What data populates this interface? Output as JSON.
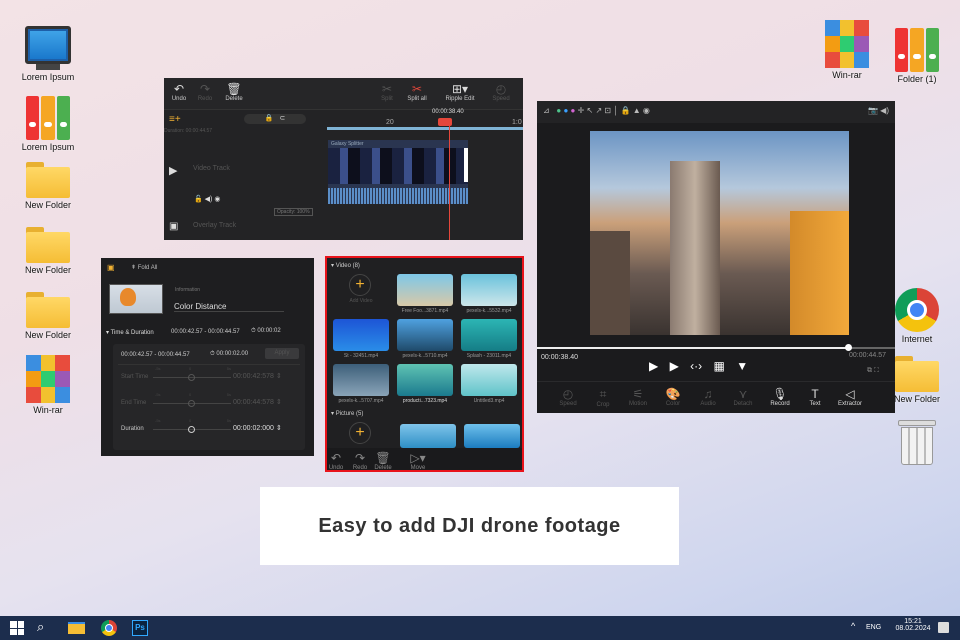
{
  "desktop": {
    "left_icons": [
      "Lorem Ipsum",
      "Lorem Ipsum",
      "New Folder",
      "New Folder",
      "New Folder",
      "Win-rar"
    ],
    "right_icons": [
      "Win-rar",
      "Folder (1)",
      "Internet",
      "New Folder"
    ]
  },
  "timeline": {
    "toolbar": {
      "undo": "Undo",
      "redo": "Redo",
      "delete": "Delete",
      "split": "Split",
      "split_all": "Split all",
      "ripple_edit": "Ripple Edit",
      "speed": "Speed"
    },
    "playhead_time": "00:00:38.40",
    "ruler_label": "20",
    "ruler_label_2": "1:0",
    "duration_label": "Duration: 00:00:44.57",
    "clip_name": "Galaxy Splitter",
    "video_track": "Video Track",
    "overlay_track": "Overlay Track",
    "opacity": "Opacity: 100%"
  },
  "inspector": {
    "fold_all": "Fold All",
    "info_label": "Information",
    "title": "Color Distance",
    "section": "Time & Duration",
    "range": "00:00:42.57 - 00:00:44.57",
    "duration_short": "00:00:02",
    "range2": "00:00:42.57 - 00:00:44.57",
    "duration_full": "00:00:02.00",
    "apply": "Apply",
    "rows": [
      {
        "label": "Start Time",
        "value": "00:00:42:578"
      },
      {
        "label": "End Time",
        "value": "00:00:44:578"
      },
      {
        "label": "Duration",
        "value": "00:00:02:000"
      }
    ],
    "slider_min": "-5s",
    "slider_mid": "0",
    "slider_max": "5s"
  },
  "media": {
    "video_header": "Video (8)",
    "add_video": "Add Video",
    "picture_header": "Picture (5)",
    "videos": [
      "Free Foo...3871.mp4",
      "pexels-k...5532.mp4",
      "St - 32451.mp4",
      "pexels-k...5710.mp4",
      "Splash - 23011.mp4",
      "pexels-k...5707.mp4",
      "producti...7323.mp4",
      "Untitled3.mp4"
    ],
    "toolbar": {
      "undo": "Undo",
      "redo": "Redo",
      "delete": "Delete",
      "move": "Move"
    }
  },
  "player": {
    "current_time": "00:00:38.40",
    "total_time": "00:00:44.57",
    "progress": 0.87,
    "tools": [
      "Speed",
      "Crop",
      "Motion",
      "Color",
      "Audio",
      "Detach",
      "Record",
      "Text",
      "Extractor"
    ]
  },
  "caption": "Easy to add DJI drone footage",
  "taskbar": {
    "lang": "ENG",
    "time": "15:21",
    "date": "08.02.2024",
    "ps": "Ps"
  }
}
